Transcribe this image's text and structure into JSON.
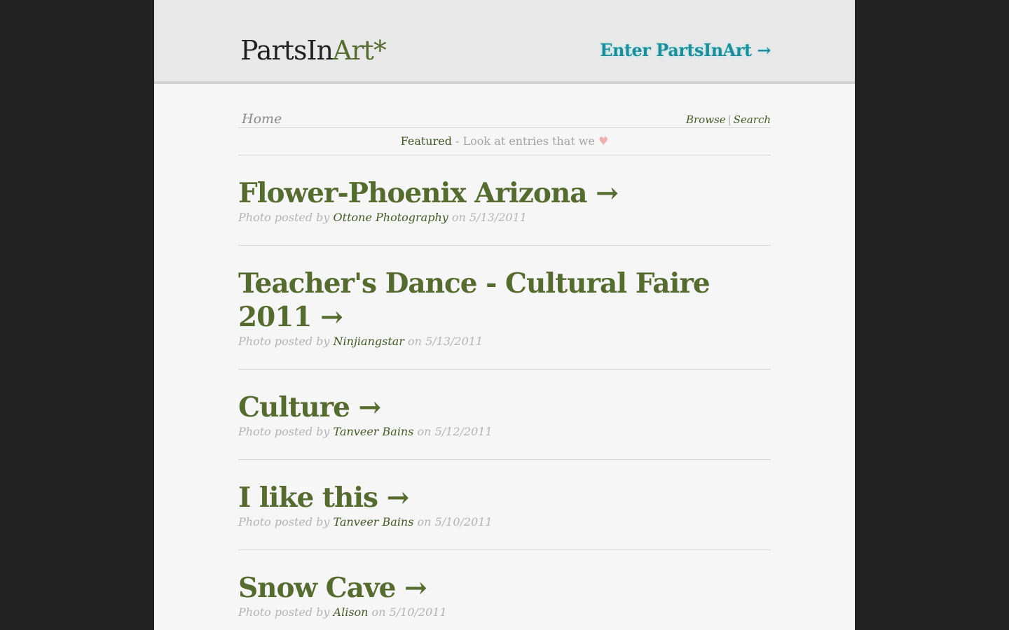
{
  "header": {
    "logo_parts": "PartsIn",
    "logo_art": "Art*",
    "enter_link": "Enter PartsInArt →"
  },
  "nav": {
    "home": "Home",
    "browse": "Browse",
    "separator": "|",
    "search": "Search"
  },
  "featured_bar": {
    "featured": "Featured",
    "text": " - Look at entries that we ",
    "heart": "♥"
  },
  "entries": [
    {
      "title": "Flower-Phoenix Arizona →",
      "prefix": "Photo posted by ",
      "author": "Ottone Photography",
      "date_text": " on 5/13/2011"
    },
    {
      "title": "Teacher's Dance - Cultural Faire 2011 →",
      "prefix": "Photo posted by ",
      "author": "Ninjiangstar",
      "date_text": " on 5/13/2011"
    },
    {
      "title": "Culture →",
      "prefix": "Photo posted by ",
      "author": "Tanveer Bains",
      "date_text": " on 5/12/2011"
    },
    {
      "title": "I like this →",
      "prefix": "Photo posted by ",
      "author": "Tanveer Bains",
      "date_text": " on 5/10/2011"
    },
    {
      "title": "Snow Cave →",
      "prefix": "Photo posted by ",
      "author": "Alison",
      "date_text": " on 5/10/2011"
    }
  ],
  "colors": {
    "background": "#222222",
    "page": "#f6f6f6",
    "header": "#e9e9e9",
    "accent_green": "#556b2f",
    "link_teal": "#1f8c98",
    "heart_pink": "#f0b0b0"
  }
}
